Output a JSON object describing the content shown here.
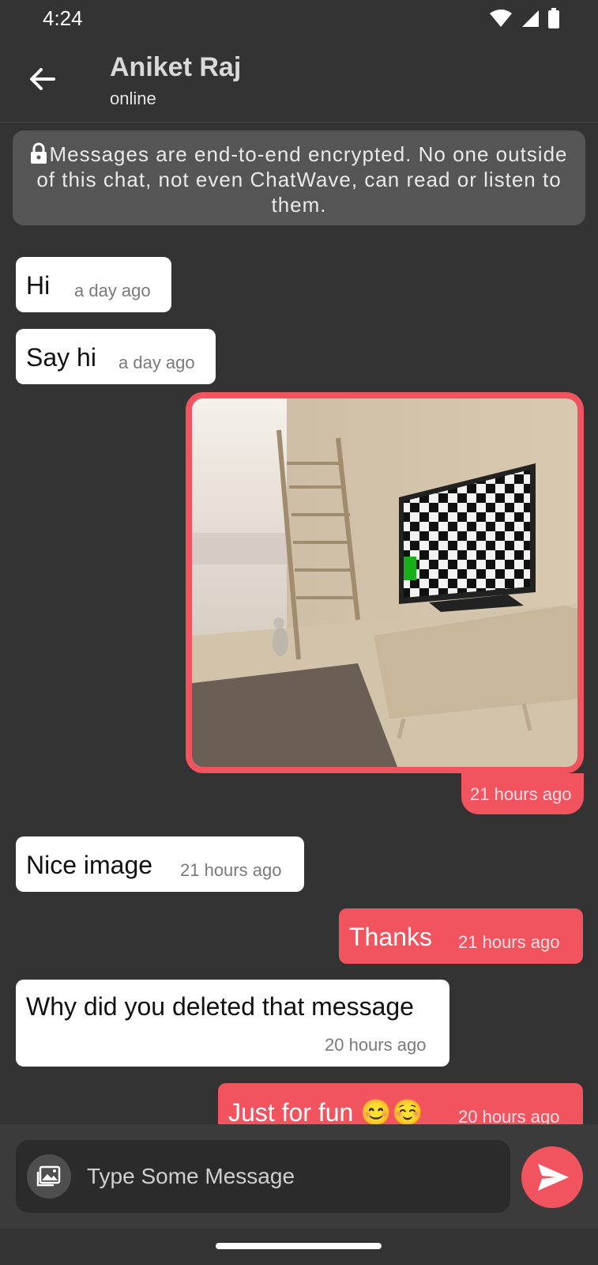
{
  "status_bar": {
    "time": "4:24"
  },
  "header": {
    "name": "Aniket Raj",
    "status": "online"
  },
  "notice": {
    "text": "Messages are end-to-end encrypted. No one outside of this chat, not even ChatWave, can read or listen to them."
  },
  "messages": [
    {
      "text": "Hi",
      "time": "a day ago"
    },
    {
      "text": "Say hi",
      "time": "a day ago"
    },
    {
      "image_time": "21 hours ago"
    },
    {
      "text": "Nice image",
      "time": "21 hours ago"
    },
    {
      "text": "Thanks",
      "time": "21 hours ago"
    },
    {
      "text": "Why did you deleted that message",
      "time": "20 hours ago"
    },
    {
      "text": "Just for fun 😊☺️",
      "time": "20 hours ago"
    }
  ],
  "input": {
    "placeholder": "Type Some Message"
  },
  "colors": {
    "accent": "#f2545f",
    "background": "#333333",
    "incoming": "#ffffff"
  },
  "icons": {
    "back": "arrow-left-icon",
    "lock": "lock-icon",
    "attach": "image-icon",
    "send": "send-icon"
  }
}
